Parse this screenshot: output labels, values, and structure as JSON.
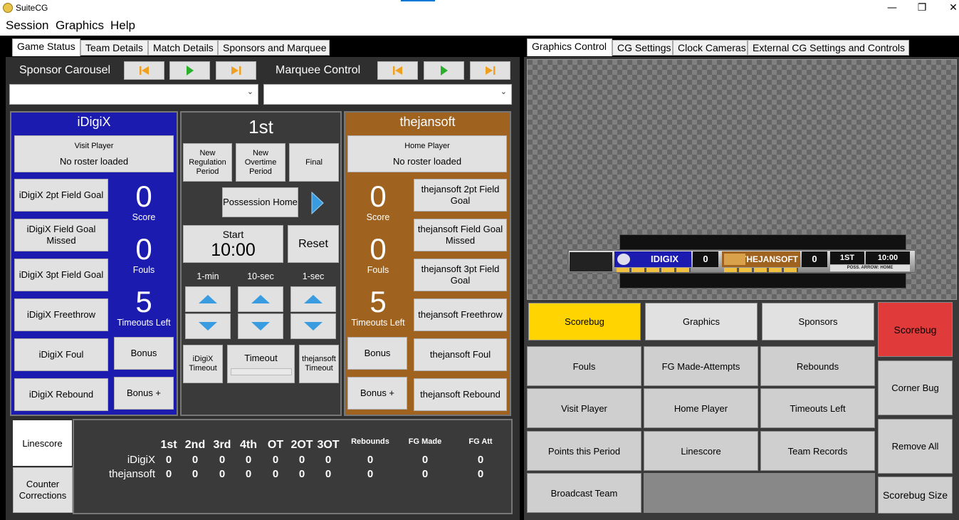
{
  "window": {
    "title": "SuiteCG",
    "controls": [
      "—",
      "❐",
      "✕"
    ]
  },
  "menu": [
    "Session",
    "Graphics",
    "Help"
  ],
  "left_tabs": [
    "Game Status",
    "Team Details",
    "Match Details",
    "Sponsors and Marquee"
  ],
  "right_tabs": [
    "Graphics Control",
    "CG Settings",
    "Clock Cameras",
    "External CG Settings and Controls"
  ],
  "sponsor": {
    "label": "Sponsor Carousel"
  },
  "marquee": {
    "label": "Marquee Control"
  },
  "away": {
    "name": "iDigiX",
    "player_label": "Visit Player",
    "player_value": "No roster loaded",
    "score": "0",
    "score_label": "Score",
    "fouls": "0",
    "fouls_label": "Fouls",
    "timeouts": "5",
    "timeouts_label": "Timeouts Left",
    "color": "#1b1bb0",
    "buttons": [
      "iDigiX 2pt Field Goal",
      "iDigiX Field Goal Missed",
      "iDigiX 3pt Field Goal",
      "iDigiX Freethrow",
      "iDigiX Foul",
      "iDigiX Rebound"
    ],
    "bonus": "Bonus",
    "bonus_plus": "Bonus +",
    "timeout_btn": "iDigiX Timeout"
  },
  "home": {
    "name": "thejansoft",
    "player_label": "Home Player",
    "player_value": "No roster loaded",
    "score": "0",
    "score_label": "Score",
    "fouls": "0",
    "fouls_label": "Fouls",
    "timeouts": "5",
    "timeouts_label": "Timeouts Left",
    "color": "#a0631f",
    "buttons": [
      "thejansoft 2pt Field Goal",
      "thejansoft Field Goal Missed",
      "thejansoft 3pt Field Goal",
      "thejansoft Freethrow",
      "thejansoft Foul",
      "thejansoft Rebound"
    ],
    "bonus": "Bonus",
    "bonus_plus": "Bonus +",
    "timeout_btn": "thejansoft Timeout"
  },
  "center": {
    "period": "1st",
    "new_reg": "New Regulation Period",
    "new_ot": "New Overtime Period",
    "final": "Final",
    "possession": "Possession Home",
    "clock_label": "Start",
    "clock": "10:00",
    "reset": "Reset",
    "inc": [
      "1-min",
      "10-sec",
      "1-sec"
    ],
    "timeout": "Timeout"
  },
  "bottom_tabs": [
    "Linescore",
    "Counter Corrections"
  ],
  "linescore": {
    "headers": [
      "1st",
      "2nd",
      "3rd",
      "4th",
      "OT",
      "2OT",
      "3OT"
    ],
    "extra_headers": [
      "Rebounds",
      "FG Made",
      "FG Att"
    ],
    "rows": [
      {
        "team": "iDigiX",
        "periods": [
          "0",
          "0",
          "0",
          "0",
          "0",
          "0",
          "0"
        ],
        "extra": [
          "0",
          "0",
          "0"
        ]
      },
      {
        "team": "thejansoft",
        "periods": [
          "0",
          "0",
          "0",
          "0",
          "0",
          "0",
          "0"
        ],
        "extra": [
          "0",
          "0",
          "0"
        ]
      }
    ]
  },
  "scorebug": {
    "away": "IDIGIX",
    "away_score": "0",
    "home": "THEJANSOFT",
    "home_score": "0",
    "period": "1ST",
    "clock": "10:00",
    "poss": "POSS. ARROW: HOME"
  },
  "graphics": {
    "top": [
      "Scorebug",
      "Graphics",
      "Sponsors"
    ],
    "grid": [
      "Fouls",
      "FG Made-Attempts",
      "Rebounds",
      "Visit Player",
      "Home Player",
      "Timeouts Left",
      "Points this Period",
      "Linescore",
      "Team Records",
      "Broadcast Team"
    ],
    "side": [
      "Scorebug",
      "Corner Bug",
      "Remove All",
      "Scorebug Size"
    ],
    "active_color": "#ffd400",
    "live_color": "#e03a3a"
  }
}
